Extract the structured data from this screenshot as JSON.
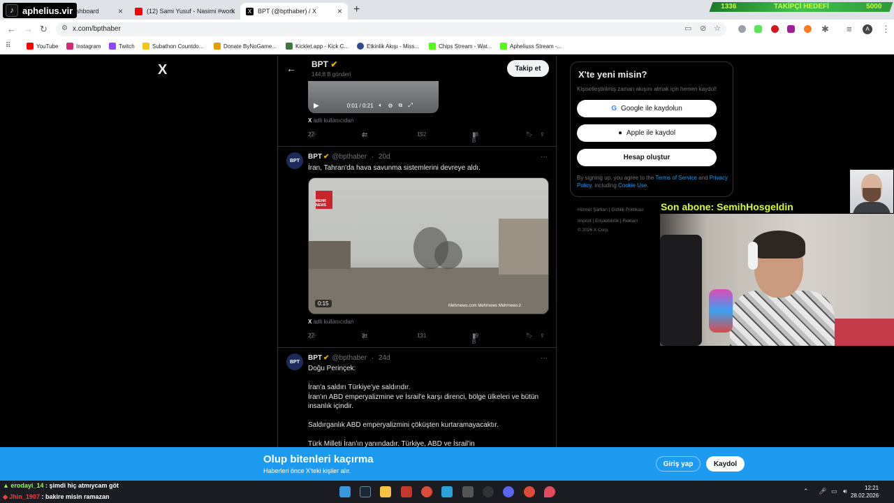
{
  "browser": {
    "overlay_name": "aphelius.vir",
    "tabs": [
      {
        "label": "ashboard"
      },
      {
        "label": "(12) Sami Yusuf - Nasimi #work"
      },
      {
        "label": "BPT (@bpthaber) / X"
      }
    ],
    "goal": {
      "left_value": "1336",
      "label": "TAKİPÇİ HEDEFİ",
      "right_value": "5000"
    },
    "url": "x.com/bpthaber",
    "bookmarks": [
      "YouTube",
      "Instagram",
      "Twitch",
      "Subathon Countdo...",
      "Donate ByNoGame...",
      "Kicklet.app - Kick C...",
      "Etkinlik Akışı - Miss...",
      "Chips Stream - Wat...",
      "Apheliuss Stream -..."
    ],
    "profile_initial": "A"
  },
  "x_logo": "X",
  "profile_header": {
    "name": "BPT",
    "post_count": "144,8 B gönderi",
    "follow_label": "Takip et"
  },
  "tweets": [
    {
      "video_time": "0:01 / 0:21",
      "from": "adlı kullanıcıdan",
      "from_prefix": "X",
      "replies": "22",
      "reposts": "4",
      "likes": "152",
      "views": "18 B"
    },
    {
      "name": "BPT",
      "handle": "@bpthaber",
      "age": "20d",
      "text": "İran, Tahran'da hava savunma sistemlerini devreye aldı.",
      "video_duration": "0:15",
      "watermark": "Mehrnews.com  Mehrnews  Mehrnews.ir",
      "logo": "MEHR NEWS",
      "from": "adlı kullanıcıdan",
      "from_prefix": "X",
      "replies": "22",
      "reposts": "3",
      "likes": "131",
      "views": "19 B"
    },
    {
      "name": "BPT",
      "handle": "@bpthaber",
      "age": "24d",
      "text": "Doğu Perinçek:\n\nİran'a saldırı Türkiye'ye saldırıdır.\nİran'ın ABD emperyalizmine ve İsrail'e karşı direnci, bölge ülkeleri ve bütün insanlık içindir.\n\nSaldırganlık ABD emperyalizmini çöküşten kurtaramayacaktır.\n\nTürk Milleti İran'ın yanındadır.  Türkiye, ABD ve İsrail'in"
    }
  ],
  "avatar_text": "BPT",
  "signup": {
    "title": "X'te yeni misin?",
    "description": "Kişiselleştirilmiş zaman akışını almak için hemen kaydol!",
    "google": "Google ile kaydolun",
    "apple": "Apple ile kaydol",
    "create": "Hesap oluştur",
    "legal_pre": "By signing up, you agree to the ",
    "terms": "Terms of Service",
    "legal_and": " and ",
    "privacy": "Privacy Policy",
    "legal_incl": ", including ",
    "cookie": "Cookie Use",
    "legal_end": "."
  },
  "footer": {
    "row1": "Hizmet Şartları  |  Gizlilik Politikası",
    "row2": "Imprint  |  Erişilebilirlik  |  Reklam",
    "copyright": "© 2026 X Corp."
  },
  "stream": {
    "last_sub": "Son abone: SemihHosgeldin"
  },
  "banner": {
    "title": "Olup bitenleri kaçırma",
    "subtitle": "Haberleri önce X'teki kişiler alır.",
    "login": "Giriş yap",
    "register": "Kaydol"
  },
  "chat": [
    {
      "user": "erodayi_14",
      "message": " : şimdi hiç atmıycam göt"
    },
    {
      "user": "Jhin_1907",
      "message": " : bakire misin ramazan"
    }
  ],
  "clock": {
    "time": "12:21",
    "date": "28.02.2026"
  }
}
